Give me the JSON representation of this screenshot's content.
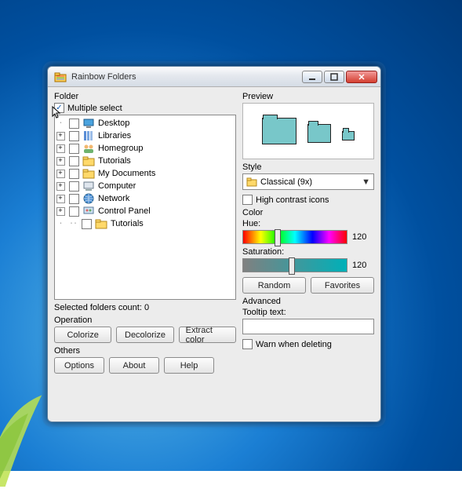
{
  "window": {
    "title": "Rainbow Folders"
  },
  "folder": {
    "label": "Folder",
    "multiple_select_label": "Multiple select",
    "multiple_select_checked": true,
    "tree": [
      {
        "label": "Desktop",
        "icon": "desktop",
        "expandable": false,
        "level": 1
      },
      {
        "label": "Libraries",
        "icon": "libraries",
        "expandable": true,
        "level": 1
      },
      {
        "label": "Homegroup",
        "icon": "homegroup",
        "expandable": true,
        "level": 1
      },
      {
        "label": "Tutorials",
        "icon": "folder",
        "expandable": true,
        "level": 1
      },
      {
        "label": "My Documents",
        "icon": "folder",
        "expandable": true,
        "level": 1
      },
      {
        "label": "Computer",
        "icon": "computer",
        "expandable": true,
        "level": 1
      },
      {
        "label": "Network",
        "icon": "network",
        "expandable": true,
        "level": 1
      },
      {
        "label": "Control Panel",
        "icon": "control",
        "expandable": true,
        "level": 1
      },
      {
        "label": "Tutorials",
        "icon": "folder",
        "expandable": false,
        "level": 2
      }
    ],
    "count_label": "Selected folders count: 0"
  },
  "operation": {
    "label": "Operation",
    "colorize": "Colorize",
    "decolorize": "Decolorize",
    "extract": "Extract color"
  },
  "others": {
    "label": "Others",
    "options": "Options",
    "about": "About",
    "help": "Help"
  },
  "preview": {
    "label": "Preview"
  },
  "style": {
    "label": "Style",
    "selected": "Classical (9x)",
    "high_contrast_label": "High contrast icons",
    "high_contrast_checked": false
  },
  "color": {
    "label": "Color",
    "hue_label": "Hue:",
    "hue_value": "120",
    "hue_percent": 33,
    "sat_label": "Saturation:",
    "sat_value": "120",
    "sat_percent": 47,
    "random": "Random",
    "favorites": "Favorites"
  },
  "advanced": {
    "label": "Advanced",
    "tooltip_label": "Tooltip text:",
    "tooltip_value": "",
    "warn_label": "Warn when deleting",
    "warn_checked": false
  }
}
